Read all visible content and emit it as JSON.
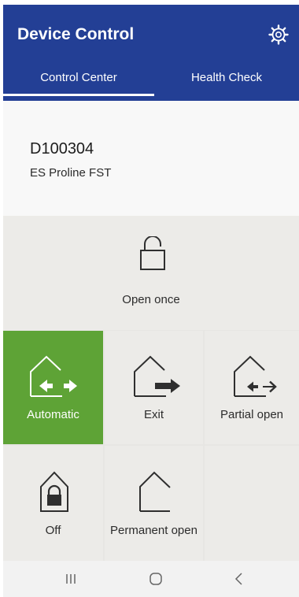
{
  "app": {
    "title": "Device Control"
  },
  "tabs": [
    {
      "label": "Control Center",
      "active": true
    },
    {
      "label": "Health Check",
      "active": false
    }
  ],
  "device": {
    "id": "D100304",
    "model": "ES Proline FST"
  },
  "modes": {
    "open_once": {
      "label": "Open once",
      "icon": "padlock-open-icon"
    },
    "automatic": {
      "label": "Automatic",
      "icon": "house-bidirectional-arrow-icon",
      "selected": true
    },
    "exit": {
      "label": "Exit",
      "icon": "house-exit-arrow-icon"
    },
    "partial_open": {
      "label": "Partial open",
      "icon": "house-partial-arrows-icon"
    },
    "off": {
      "label": "Off",
      "icon": "house-lock-icon"
    },
    "permanent_open": {
      "label": "Permanent open",
      "icon": "house-open-icon"
    }
  },
  "navigation": {
    "recents": "recent-apps-icon",
    "home": "home-icon",
    "back": "back-icon"
  },
  "colors": {
    "appbar": "#233f95",
    "selected_tile": "#5ea336",
    "tile_background": "#ecebe8"
  }
}
